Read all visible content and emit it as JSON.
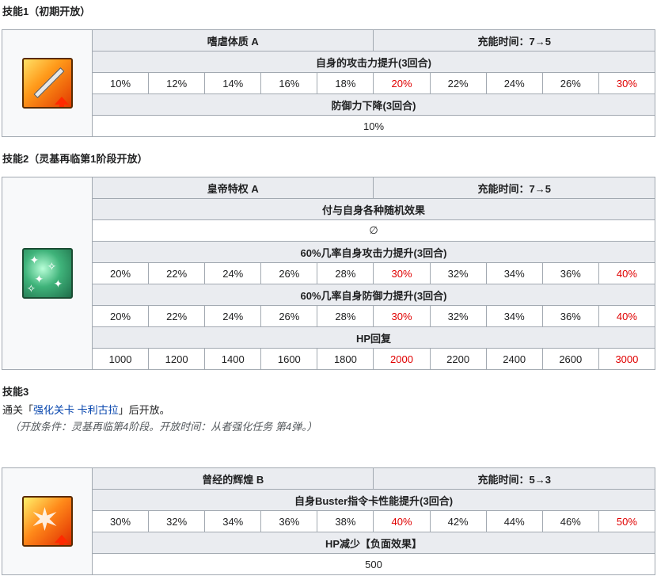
{
  "skill1": {
    "heading": "技能1（初期开放）",
    "name": "嗜虐体质 A",
    "cooldown": "充能时间：7→5",
    "effects": [
      {
        "title": "自身的攻击力提升(3回合)",
        "values": [
          "10%",
          "12%",
          "14%",
          "16%",
          "18%",
          "20%",
          "22%",
          "24%",
          "26%",
          "30%"
        ]
      },
      {
        "title": "防御力下降(3回合)",
        "single": "10%"
      }
    ],
    "icon": "sword-attack-up-icon"
  },
  "skill2": {
    "heading": "技能2（灵基再临第1阶段开放）",
    "name": "皇帝特权 A",
    "cooldown": "充能时间：7→5",
    "effects": [
      {
        "title": "付与自身各种随机效果",
        "single": "∅"
      },
      {
        "title": "60%几率自身攻击力提升(3回合)",
        "values": [
          "20%",
          "22%",
          "24%",
          "26%",
          "28%",
          "30%",
          "32%",
          "34%",
          "36%",
          "40%"
        ]
      },
      {
        "title": "60%几率自身防御力提升(3回合)",
        "values": [
          "20%",
          "22%",
          "24%",
          "26%",
          "28%",
          "30%",
          "32%",
          "34%",
          "36%",
          "40%"
        ]
      },
      {
        "title": "HP回复",
        "values": [
          "1000",
          "1200",
          "1400",
          "1600",
          "1800",
          "2000",
          "2200",
          "2400",
          "2600",
          "3000"
        ]
      }
    ],
    "icon": "sparkle-icon"
  },
  "skill3": {
    "heading": "技能3",
    "unlock_prefix": "通关「",
    "unlock_link": "强化关卡 卡利古拉",
    "unlock_suffix": "」后开放。",
    "note": "（开放条件：灵基再临第4阶段。开放时间：从者强化任务 第4弹。）",
    "name": "曾经的辉煌 B",
    "cooldown": "充能时间：5→3",
    "effects": [
      {
        "title": "自身Buster指令卡性能提升(3回合)",
        "values": [
          "30%",
          "32%",
          "34%",
          "36%",
          "38%",
          "40%",
          "42%",
          "44%",
          "46%",
          "50%"
        ]
      },
      {
        "title": "HP减少【负面效果】",
        "single": "500"
      }
    ],
    "icon": "buster-burst-icon"
  },
  "colors": {
    "highlight": "#e00000",
    "header_bg": "#eaecf0",
    "border": "#a2a9b1"
  }
}
